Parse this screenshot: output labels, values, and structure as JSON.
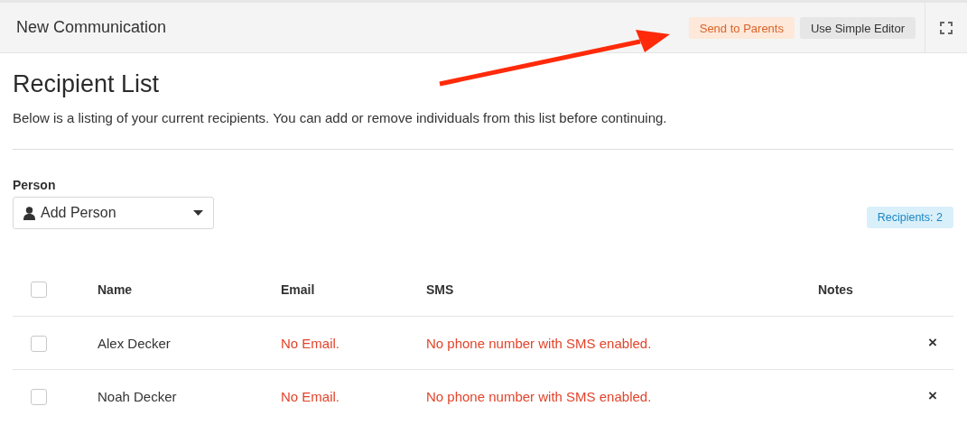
{
  "header": {
    "title": "New Communication",
    "buttons": [
      {
        "label": "Send to Parents",
        "kind": "warning"
      },
      {
        "label": "Use Simple Editor",
        "kind": "default"
      }
    ]
  },
  "page": {
    "heading": "Recipient List",
    "description": "Below is a listing of your current recipients. You can add or remove individuals from this list before continuing."
  },
  "person_picker": {
    "label": "Person",
    "placeholder": "Add Person"
  },
  "recipient_count": "Recipients: 2",
  "table": {
    "select_all_checked": false,
    "columns": [
      "Name",
      "Email",
      "SMS",
      "Notes"
    ],
    "rows": [
      {
        "checked": false,
        "name": "Alex Decker",
        "email": "No Email.",
        "sms": "No phone number with SMS enabled.",
        "notes": "",
        "remove": "×"
      },
      {
        "checked": false,
        "name": "Noah Decker",
        "email": "No Email.",
        "sms": "No phone number with SMS enabled.",
        "notes": "",
        "remove": "×"
      }
    ]
  }
}
